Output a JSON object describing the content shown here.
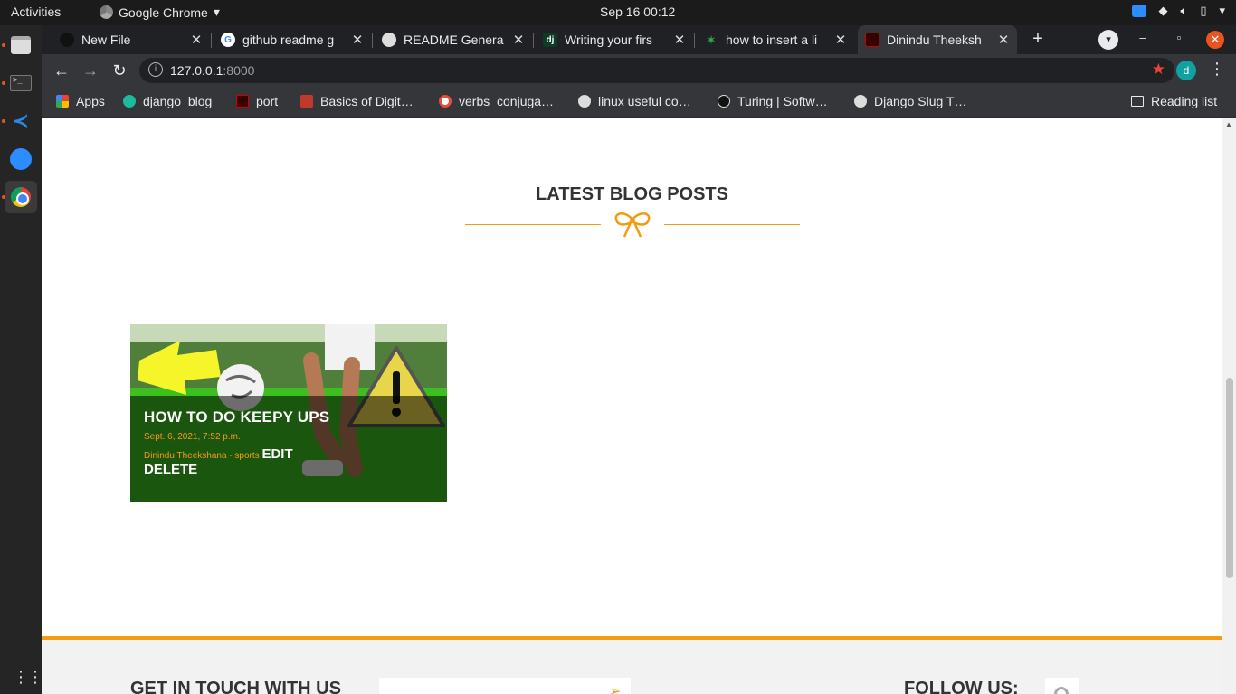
{
  "system": {
    "activities": "Activities",
    "app_name": "Google Chrome",
    "clock": "Sep 16  00:12"
  },
  "tabs": [
    {
      "title": "New File",
      "icon": "github-icon"
    },
    {
      "title": "github readme g",
      "icon": "google-icon"
    },
    {
      "title": "README Genera",
      "icon": "globe-icon"
    },
    {
      "title": "Writing your firs",
      "icon": "django-icon",
      "icon_text": "dj"
    },
    {
      "title": "how to insert a li",
      "icon": "star-icon"
    },
    {
      "title": "Dinindu Theeksh",
      "icon": "site-icon"
    }
  ],
  "toolbar": {
    "url_host": "127.0.0.1",
    "url_port": ":8000",
    "profile_initial": "d"
  },
  "bookmarks": [
    {
      "label": "Apps",
      "icon": "apps-icon"
    },
    {
      "label": "django_blog",
      "icon": "python-icon"
    },
    {
      "label": "port",
      "icon": "site-icon"
    },
    {
      "label": "Basics of Digit…",
      "icon": "iit-icon"
    },
    {
      "label": "verbs_conjuga…",
      "icon": "verbs-icon"
    },
    {
      "label": "linux useful co…",
      "icon": "linux-icon"
    },
    {
      "label": "Turing | Softw…",
      "icon": "turing-icon"
    },
    {
      "label": "Django Slug T…",
      "icon": "globe-icon"
    }
  ],
  "reading_list": "Reading list",
  "page": {
    "section_title": "LATEST BLOG POSTS",
    "post": {
      "title": "HOW TO DO KEEPY UPS",
      "date": "Sept. 6, 2021, 7:52 p.m.",
      "author_category": "Dinindu Theekshana - sports",
      "edit_label": "EDIT",
      "delete_label": "DELETE"
    },
    "footer": {
      "get_in_touch": "GET IN TOUCH WITH US",
      "follow_us": "FOLLOW US:"
    }
  },
  "colors": {
    "accent": "#f39c12",
    "chrome_dark": "#202124",
    "chrome_toolbar": "#35363a"
  }
}
